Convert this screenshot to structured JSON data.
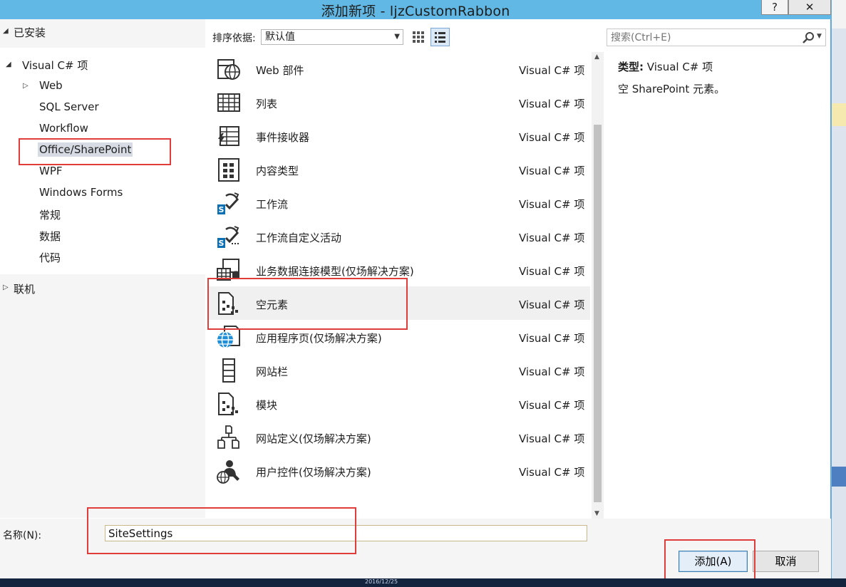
{
  "window": {
    "title": "添加新项 - ljzCustomRabbon",
    "help_glyph": "?",
    "close_glyph": "✕"
  },
  "left": {
    "installed": "已安装",
    "tree": [
      {
        "label": "Visual C# 项",
        "arrow": "◢"
      },
      {
        "label": "Web",
        "arrow": "▷"
      },
      {
        "label": "SQL Server"
      },
      {
        "label": "Workflow"
      },
      {
        "label": "Office/SharePoint",
        "selected": true
      },
      {
        "label": "WPF"
      },
      {
        "label": "Windows Forms"
      },
      {
        "label": "常规"
      },
      {
        "label": "数据"
      },
      {
        "label": "代码"
      }
    ],
    "online": "联机"
  },
  "toolbar": {
    "sort_label": "排序依据:",
    "sort_value": "默认值",
    "search_placeholder": "搜索(Ctrl+E)"
  },
  "items": [
    {
      "name": "Web 部件",
      "type": "Visual C# 项",
      "icon": "web-part-icon"
    },
    {
      "name": "列表",
      "type": "Visual C# 项",
      "icon": "list-icon"
    },
    {
      "name": "事件接收器",
      "type": "Visual C# 项",
      "icon": "event-receiver-icon"
    },
    {
      "name": "内容类型",
      "type": "Visual C# 项",
      "icon": "content-type-icon"
    },
    {
      "name": "工作流",
      "type": "Visual C# 项",
      "icon": "workflow-icon"
    },
    {
      "name": "工作流自定义活动",
      "type": "Visual C# 项",
      "icon": "workflow-activity-icon"
    },
    {
      "name": "业务数据连接模型(仅场解决方案)",
      "type": "Visual C# 项",
      "icon": "bdc-model-icon"
    },
    {
      "name": "空元素",
      "type": "Visual C# 项",
      "icon": "empty-element-icon",
      "selected": true
    },
    {
      "name": "应用程序页(仅场解决方案)",
      "type": "Visual C# 项",
      "icon": "application-page-icon"
    },
    {
      "name": "网站栏",
      "type": "Visual C# 项",
      "icon": "site-column-icon"
    },
    {
      "name": "模块",
      "type": "Visual C# 项",
      "icon": "module-icon"
    },
    {
      "name": "网站定义(仅场解决方案)",
      "type": "Visual C# 项",
      "icon": "site-definition-icon"
    },
    {
      "name": "用户控件(仅场解决方案)",
      "type": "Visual C# 项",
      "icon": "user-control-icon"
    }
  ],
  "description": {
    "type_label": "类型:",
    "type_value": "Visual C# 项",
    "text": "空 SharePoint 元素。"
  },
  "bottom": {
    "name_label": "名称(N):",
    "name_value": "SiteSettings",
    "add_label": "添加(A)",
    "cancel_label": "取消"
  },
  "taskbar": {
    "date": "2016/12/25"
  },
  "colors": {
    "title_bar": "#61b8e4",
    "annotation": "#e03c3c",
    "selection": "#d6dbe4",
    "sharepoint_blue": "#0b6fb4"
  }
}
